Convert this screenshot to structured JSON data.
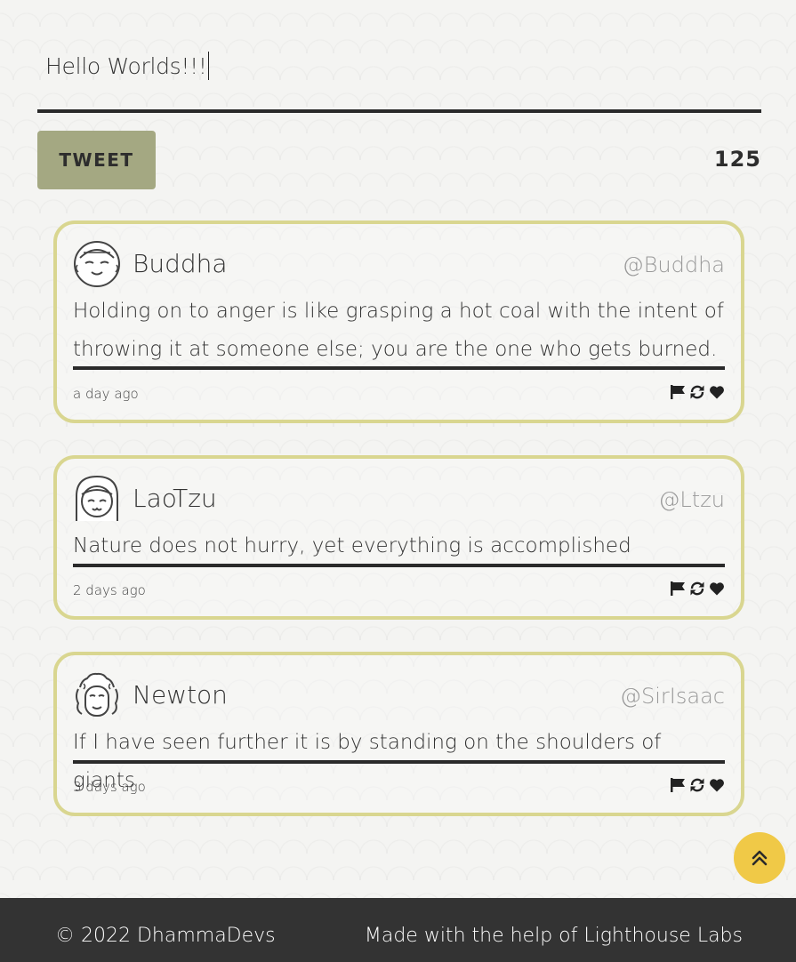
{
  "composer": {
    "text": "Hello Worlds!!!",
    "button_label": "TWEET",
    "char_count": "125"
  },
  "tweets": [
    {
      "name": "Buddha",
      "handle": "@Buddha",
      "avatar_icon": "buddha-avatar",
      "text": "Holding on to anger is like grasping a hot coal with the intent of throwing it at someone else; you are the one who gets burned.",
      "time": "a day ago"
    },
    {
      "name": "LaoTzu",
      "handle": "@Ltzu",
      "avatar_icon": "laotzu-avatar",
      "text": "Nature does not hurry, yet everything is accomplished",
      "time": "2 days ago"
    },
    {
      "name": "Newton",
      "handle": "@SirIsaac",
      "avatar_icon": "newton-avatar",
      "text": "If I have seen further it is by standing on the shoulders of giants",
      "time": "3 days ago"
    }
  ],
  "actions": [
    "flag-icon",
    "retweet-icon",
    "heart-icon"
  ],
  "footer": {
    "copyright": "© 2022 DhammaDevs",
    "credit": "Made with the help of Lighthouse Labs"
  },
  "colors": {
    "accent_border": "#d9d690",
    "button": "#a4a882",
    "scroll_button": "#f0c947",
    "footer": "#333333"
  }
}
